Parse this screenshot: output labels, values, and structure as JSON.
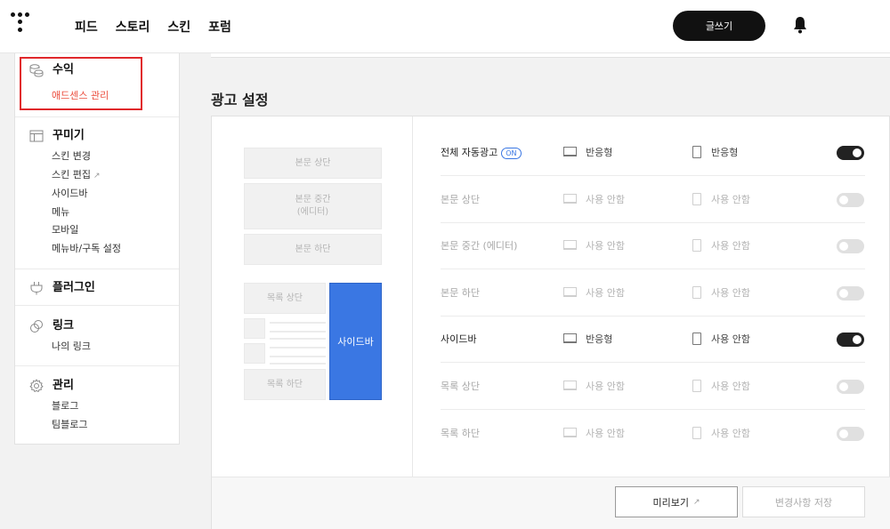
{
  "header": {
    "nav": [
      "피드",
      "스토리",
      "스킨",
      "포럼"
    ],
    "write_label": "글쓰기"
  },
  "sidebar": {
    "revenue": {
      "title": "수익",
      "items": [
        "애드센스 관리"
      ]
    },
    "decorate": {
      "title": "꾸미기",
      "items": [
        "스킨 변경",
        "스킨 편집",
        "사이드바",
        "메뉴",
        "모바일",
        "메뉴바/구독 설정"
      ]
    },
    "plugin": {
      "title": "플러그인"
    },
    "link": {
      "title": "링크",
      "items": [
        "나의 링크"
      ]
    },
    "manage": {
      "title": "관리",
      "items": [
        "블로그",
        "팀블로그"
      ]
    }
  },
  "section_title": "광고 설정",
  "preview": {
    "body_top": "본문 상단",
    "body_middle": "본문 중간\n(에디터)",
    "body_bottom": "본문 하단",
    "list_top": "목록 상단",
    "list_bottom": "목록 하단",
    "sidebar": "사이드바"
  },
  "on_badge": "ON",
  "rows": [
    {
      "label": "전체 자동광고",
      "pc": "반응형",
      "mobile": "반응형",
      "enabled": true
    },
    {
      "label": "본문 상단",
      "pc": "사용 안함",
      "mobile": "사용 안함",
      "enabled": false
    },
    {
      "label": "본문 중간 (에디터)",
      "pc": "사용 안함",
      "mobile": "사용 안함",
      "enabled": false
    },
    {
      "label": "본문 하단",
      "pc": "사용 안함",
      "mobile": "사용 안함",
      "enabled": false
    },
    {
      "label": "사이드바",
      "pc": "반응형",
      "mobile": "사용 안함",
      "enabled": true
    },
    {
      "label": "목록 상단",
      "pc": "사용 안함",
      "mobile": "사용 안함",
      "enabled": false
    },
    {
      "label": "목록 하단",
      "pc": "사용 안함",
      "mobile": "사용 안함",
      "enabled": false
    }
  ],
  "buttons": {
    "preview": "미리보기",
    "save": "변경사항 저장"
  },
  "colors": {
    "accent": "#3a77e3",
    "active_menu": "#eb4d3d",
    "highlight_box": "#e0282b"
  }
}
